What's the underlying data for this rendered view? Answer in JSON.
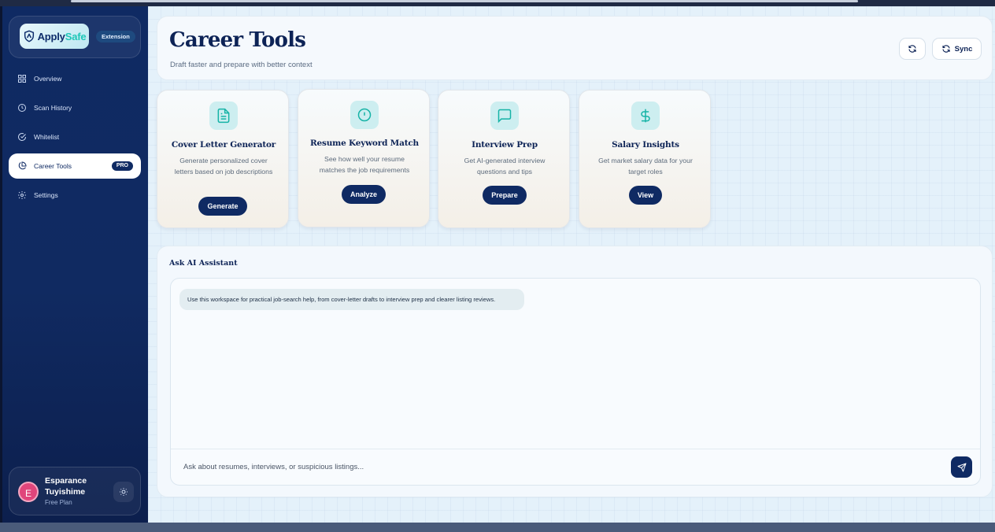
{
  "brand": {
    "logo_prefix": "Apply",
    "logo_accent": "Safe",
    "badge": "Extension"
  },
  "sidebar": {
    "items": [
      {
        "label": "Overview",
        "icon": "grid-icon"
      },
      {
        "label": "Scan History",
        "icon": "clock-icon"
      },
      {
        "label": "Whitelist",
        "icon": "check-circle-icon"
      },
      {
        "label": "Career Tools",
        "icon": "pie-chart-icon",
        "active": true,
        "badge": "PRO"
      },
      {
        "label": "Settings",
        "icon": "gear-icon"
      }
    ]
  },
  "user": {
    "initial": "E",
    "name": "Esparance Tuyishime",
    "plan": "Free Plan"
  },
  "header": {
    "title": "Career Tools",
    "subtitle": "Draft faster and prepare with better context",
    "sync_label": "Sync"
  },
  "tools": [
    {
      "title": "Cover Letter Generator",
      "description": "Generate personalized cover letters based on job descriptions",
      "button": "Generate",
      "icon": "document-icon"
    },
    {
      "title": "Resume Keyword Match",
      "description": "See how well your resume matches the job requirements",
      "button": "Analyze",
      "icon": "alert-circle-icon"
    },
    {
      "title": "Interview Prep",
      "description": "Get AI-generated interview questions and tips",
      "button": "Prepare",
      "icon": "message-square-icon"
    },
    {
      "title": "Salary Insights",
      "description": "Get market salary data for your target roles",
      "button": "View",
      "icon": "dollar-icon"
    }
  ],
  "assistant": {
    "heading": "Ask AI Assistant",
    "message": "Use this workspace for practical job-search help, from cover-letter drafts to interview prep and clearer listing reviews.",
    "placeholder": "Ask about resumes, interviews, or suspicious listings..."
  },
  "colors": {
    "navy": "#0f2a63",
    "teal_accent": "#1ec7b8",
    "avatar": "#e0457b"
  }
}
